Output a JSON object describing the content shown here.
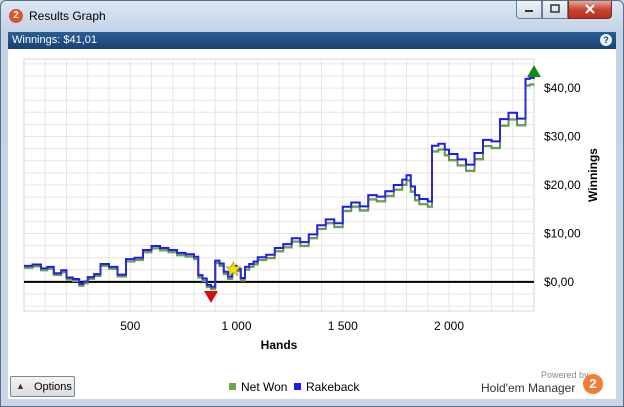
{
  "window": {
    "title": "Results Graph"
  },
  "header": {
    "winnings_label": "Winnings: $41,01",
    "help": "?"
  },
  "options": {
    "label": "Options"
  },
  "legend": [
    {
      "label": "Net Won",
      "color": "#6aa84f"
    },
    {
      "label": "Rakeback",
      "color": "#1c1cf0"
    }
  ],
  "branding": {
    "powered_by": "Powered by",
    "name": "Hold'em Manager",
    "logo": "2"
  },
  "colors": {
    "net_won_line": "#6aa84f",
    "rakeback_line": "#1c1cf0",
    "zero_line": "#000000",
    "marker_high": "#138a13",
    "marker_low": "#d01010",
    "marker_star": "#f5e400"
  },
  "chart_data": {
    "type": "line",
    "xlabel": "Hands",
    "ylabel": "Winnings",
    "xlim": [
      0,
      2400
    ],
    "ylim": [
      -6,
      46
    ],
    "x_ticks": [
      {
        "value": 500,
        "label": "500"
      },
      {
        "value": 1000,
        "label": "1 000"
      },
      {
        "value": 1500,
        "label": "1 500"
      },
      {
        "value": 2000,
        "label": "2 000"
      }
    ],
    "y_ticks": [
      {
        "value": 0,
        "label": "$0,00"
      },
      {
        "value": 10,
        "label": "$10,00"
      },
      {
        "value": 20,
        "label": "$20,00"
      },
      {
        "value": 30,
        "label": "$30,00"
      },
      {
        "value": 40,
        "label": "$40,00"
      }
    ],
    "grid": true,
    "legend_position": "bottom",
    "x": [
      0,
      40,
      80,
      110,
      140,
      175,
      200,
      230,
      260,
      280,
      300,
      330,
      360,
      400,
      440,
      480,
      520,
      560,
      600,
      640,
      680,
      720,
      760,
      800,
      820,
      840,
      860,
      880,
      900,
      920,
      940,
      960,
      980,
      1000,
      1020,
      1040,
      1060,
      1080,
      1100,
      1140,
      1180,
      1220,
      1260,
      1300,
      1340,
      1380,
      1420,
      1460,
      1500,
      1540,
      1580,
      1620,
      1660,
      1700,
      1740,
      1780,
      1800,
      1820,
      1840,
      1860,
      1900,
      1920,
      1950,
      1980,
      2000,
      2040,
      2080,
      2120,
      2160,
      2200,
      2240,
      2280,
      2320,
      2360,
      2380,
      2400
    ],
    "series": [
      {
        "name": "Net Won",
        "values": [
          3.2,
          3.5,
          2.7,
          3.0,
          1.7,
          2.3,
          0.8,
          0.5,
          -0.5,
          0.0,
          0.9,
          1.5,
          3.6,
          3.0,
          1.4,
          4.5,
          4.8,
          6.4,
          7.2,
          6.8,
          6.4,
          5.8,
          5.5,
          5.0,
          1.2,
          0.5,
          -0.8,
          -1.2,
          4.2,
          3.6,
          1.9,
          0.9,
          3.1,
          2.5,
          0.6,
          2.8,
          3.4,
          3.9,
          4.8,
          5.2,
          6.6,
          7.4,
          8.6,
          7.7,
          9.3,
          11.2,
          12.4,
          11.6,
          14.9,
          15.8,
          15.0,
          17.3,
          16.9,
          18.0,
          19.3,
          20.3,
          21.2,
          18.9,
          17.1,
          16.3,
          15.8,
          27.2,
          27.6,
          26.4,
          25.4,
          24.3,
          23.2,
          25.6,
          28.3,
          27.9,
          32.5,
          33.8,
          32.6,
          40.8,
          41.0,
          41.01
        ]
      },
      {
        "name": "Rakeback",
        "values": [
          3.3,
          3.6,
          2.8,
          3.1,
          1.8,
          2.4,
          0.9,
          0.6,
          -0.4,
          0.1,
          1.0,
          1.6,
          3.7,
          3.1,
          1.5,
          4.7,
          5.0,
          6.6,
          7.4,
          7.0,
          6.6,
          6.0,
          5.7,
          5.2,
          1.4,
          0.7,
          -0.6,
          -1.0,
          4.4,
          3.8,
          2.1,
          1.1,
          3.3,
          2.7,
          0.8,
          3.1,
          3.7,
          4.2,
          5.1,
          5.6,
          7.0,
          7.8,
          9.0,
          8.2,
          9.8,
          11.7,
          12.9,
          12.1,
          15.5,
          16.4,
          15.6,
          17.9,
          17.6,
          18.7,
          20.0,
          21.1,
          22.0,
          19.7,
          17.9,
          17.1,
          16.6,
          28.1,
          28.5,
          27.3,
          26.4,
          25.3,
          24.2,
          26.6,
          29.3,
          29.0,
          33.6,
          34.9,
          33.7,
          41.9,
          42.1,
          42.2
        ]
      }
    ],
    "markers": [
      {
        "type": "triangle-down",
        "x": 880,
        "y": -3.1,
        "color": "#d01010"
      },
      {
        "type": "star",
        "x": 985,
        "y": 2.6,
        "color": "#f5e400"
      },
      {
        "type": "triangle-up",
        "x": 2400,
        "y": 43.5,
        "color": "#138a13"
      }
    ]
  }
}
